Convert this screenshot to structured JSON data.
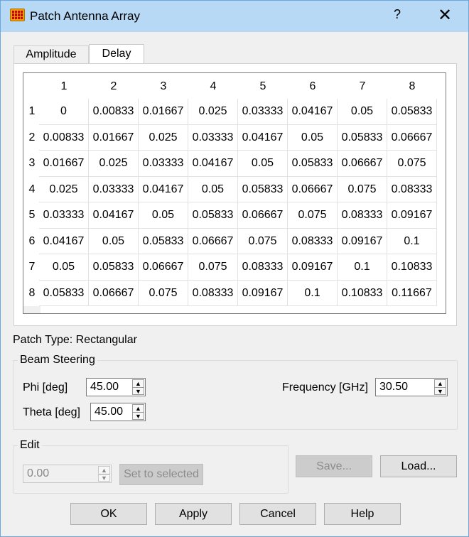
{
  "window": {
    "title": "Patch Antenna Array",
    "help_glyph": "?",
    "close_glyph": "✕"
  },
  "tabs": [
    {
      "label": "Amplitude",
      "active": false
    },
    {
      "label": "Delay",
      "active": true
    }
  ],
  "table": {
    "columns": [
      "1",
      "2",
      "3",
      "4",
      "5",
      "6",
      "7",
      "8"
    ],
    "row_headers": [
      "1",
      "2",
      "3",
      "4",
      "5",
      "6",
      "7",
      "8"
    ],
    "rows": [
      [
        "0",
        "0.00833",
        "0.01667",
        "0.025",
        "0.03333",
        "0.04167",
        "0.05",
        "0.05833"
      ],
      [
        "0.00833",
        "0.01667",
        "0.025",
        "0.03333",
        "0.04167",
        "0.05",
        "0.05833",
        "0.06667"
      ],
      [
        "0.01667",
        "0.025",
        "0.03333",
        "0.04167",
        "0.05",
        "0.05833",
        "0.06667",
        "0.075"
      ],
      [
        "0.025",
        "0.03333",
        "0.04167",
        "0.05",
        "0.05833",
        "0.06667",
        "0.075",
        "0.08333"
      ],
      [
        "0.03333",
        "0.04167",
        "0.05",
        "0.05833",
        "0.06667",
        "0.075",
        "0.08333",
        "0.09167"
      ],
      [
        "0.04167",
        "0.05",
        "0.05833",
        "0.06667",
        "0.075",
        "0.08333",
        "0.09167",
        "0.1"
      ],
      [
        "0.05",
        "0.05833",
        "0.06667",
        "0.075",
        "0.08333",
        "0.09167",
        "0.1",
        "0.10833"
      ],
      [
        "0.05833",
        "0.06667",
        "0.075",
        "0.08333",
        "0.09167",
        "0.1",
        "0.10833",
        "0.11667"
      ]
    ]
  },
  "patch_type": "Patch Type: Rectangular",
  "beam_steering": {
    "label": "Beam Steering",
    "phi_label": "Phi [deg]",
    "phi_value": "45.00",
    "theta_label": "Theta [deg]",
    "theta_value": "45.00",
    "frequency_label": "Frequency [GHz]",
    "frequency_value": "30.50"
  },
  "edit": {
    "label": "Edit",
    "value": "0.00",
    "set_button": "Set to selected"
  },
  "file_buttons": {
    "save": "Save...",
    "load": "Load..."
  },
  "dialog_buttons": {
    "ok": "OK",
    "apply": "Apply",
    "cancel": "Cancel",
    "help": "Help"
  },
  "spin_up_glyph": "▲",
  "spin_down_glyph": "▼"
}
